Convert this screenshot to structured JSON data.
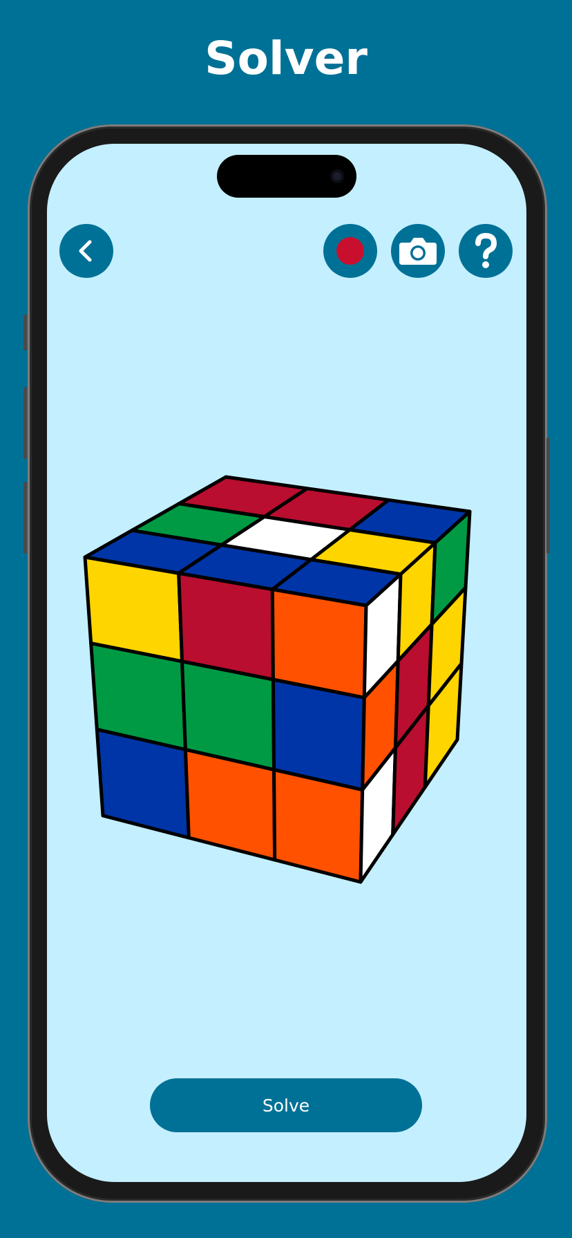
{
  "page": {
    "title": "Solver"
  },
  "toolbar": {
    "back_icon": "chevron-left-icon",
    "record_icon": "record-icon",
    "camera_icon": "camera-icon",
    "help_icon": "question-mark-icon"
  },
  "solve_button": {
    "label": "Solve"
  },
  "colors": {
    "background": "#007196",
    "screen": "#c4efff",
    "accent": "#007196",
    "record": "#c8102e",
    "red": "#b90e2f",
    "green": "#009a44",
    "blue": "#0035a7",
    "white": "#ffffff",
    "yellow": "#ffd500",
    "orange": "#ff5100"
  },
  "cube": {
    "top_face": [
      [
        "red",
        "red",
        "blue"
      ],
      [
        "green",
        "white",
        "yellow"
      ],
      [
        "blue",
        "blue",
        "blue"
      ]
    ],
    "front_face": [
      [
        "yellow",
        "red",
        "orange"
      ],
      [
        "green",
        "green",
        "blue"
      ],
      [
        "blue",
        "orange",
        "orange"
      ]
    ],
    "right_face": [
      [
        "white",
        "yellow",
        "green"
      ],
      [
        "orange",
        "red",
        "yellow"
      ],
      [
        "white",
        "red",
        "yellow"
      ]
    ]
  }
}
